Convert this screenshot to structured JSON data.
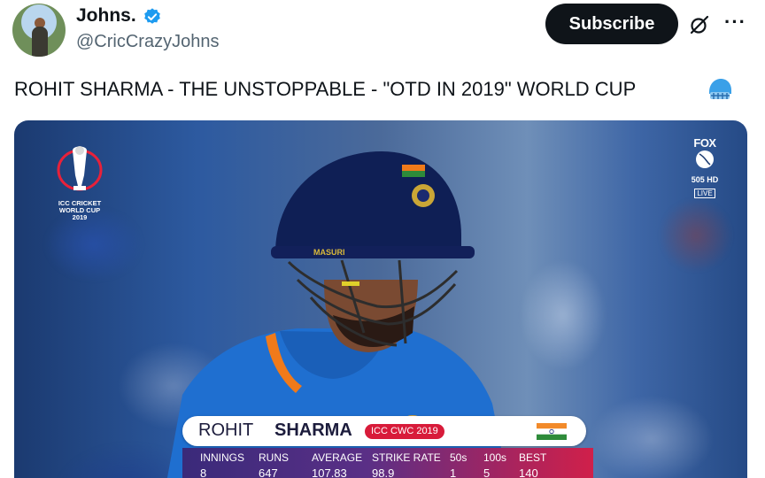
{
  "author": {
    "display_name": "Johns.",
    "handle": "@CricCrazyJohns",
    "avatar_icon": "avatar-photo",
    "verified_icon": "verified-badge-icon"
  },
  "header": {
    "subscribe_label": "Subscribe",
    "grok_icon": "grok-icon",
    "more_icon": "more-options-icon",
    "more_glyph": "···"
  },
  "tweet": {
    "text": "ROHIT SHARMA - THE UNSTOPPABLE - \"OTD IN 2019\" WORLD CUP",
    "emoji_icon": "helmet-emoji-icon"
  },
  "media": {
    "logo": {
      "line1": "ICC CRICKET",
      "line2": "WORLD CUP",
      "line3": "2019"
    },
    "broadcaster": {
      "name": "FOX",
      "channel": "505 HD",
      "live": "LIVE"
    },
    "helmet_brand": "MASURI",
    "scorecard": {
      "first_name": "ROHIT",
      "last_name": "SHARMA",
      "tournament_badge": "ICC CWC 2019",
      "flag_icon": "india-flag-icon",
      "stats": [
        {
          "label": "INNINGS",
          "value": "8"
        },
        {
          "label": "RUNS",
          "value": "647"
        },
        {
          "label": "AVERAGE",
          "value": "107.83"
        },
        {
          "label": "STRIKE RATE",
          "value": "98.9"
        },
        {
          "label": "50s",
          "value": "1"
        },
        {
          "label": "100s",
          "value": "5"
        },
        {
          "label": "BEST",
          "value": "140"
        }
      ]
    }
  },
  "colors": {
    "brand_blue": "#1d9bf0",
    "button_black": "#0f1419",
    "badge_red": "#d81b3a",
    "text_secondary": "#536471"
  }
}
